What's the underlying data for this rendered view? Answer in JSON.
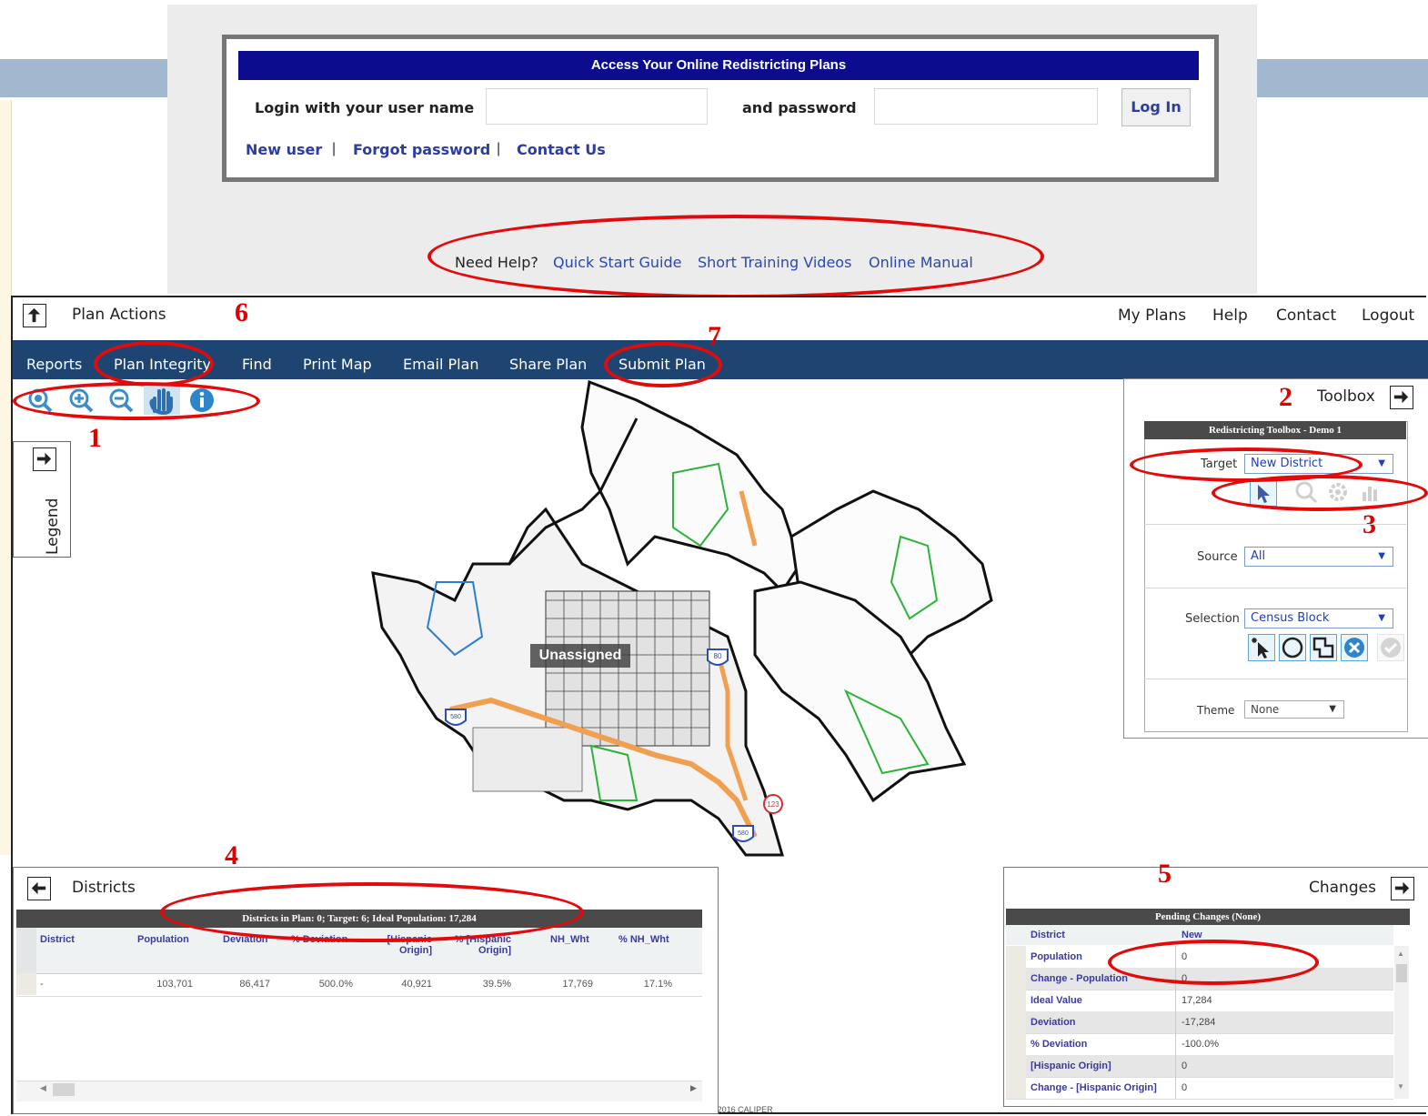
{
  "login": {
    "header": "Access Your Online Redistricting Plans",
    "username_label": "Login with your user name",
    "password_label": "and password",
    "login_button": "Log In",
    "links": {
      "new_user": "New user",
      "forgot_password": "Forgot password",
      "contact_us": "Contact Us",
      "sep": "|"
    }
  },
  "help": {
    "prefix": "Need Help?",
    "quick_start": "Quick Start Guide",
    "videos": "Short Training Videos",
    "manual": "Online Manual"
  },
  "topbar": {
    "title": "Plan Actions",
    "right_links": [
      "My Plans",
      "Help",
      "Contact",
      "Logout"
    ]
  },
  "menu": [
    "Reports",
    "Plan Integrity",
    "Find",
    "Print Map",
    "Email Plan",
    "Share Plan",
    "Submit Plan"
  ],
  "annotations": [
    "1",
    "2",
    "3",
    "4",
    "5",
    "6",
    "7"
  ],
  "legend": {
    "label": "Legend"
  },
  "map": {
    "label": "Unassigned",
    "shields": [
      "80",
      "580",
      "123",
      "580"
    ],
    "copyright": "©2016 CALIPER"
  },
  "toolbox": {
    "heading": "Toolbox",
    "panel_title": "Redistricting Toolbox - Demo 1",
    "target": {
      "label": "Target",
      "value": "New District"
    },
    "source": {
      "label": "Source",
      "value": "All"
    },
    "selection": {
      "label": "Selection",
      "value": "Census Block"
    },
    "theme": {
      "label": "Theme",
      "value": "None"
    }
  },
  "districts": {
    "heading": "Districts",
    "table_title": "Districts in Plan: 0; Target: 6; Ideal Population: 17,284",
    "columns": [
      "District",
      "Population",
      "Deviation",
      "% Deviation",
      "[Hispanic Origin]",
      "% [Hispanic Origin]",
      "NH_Wht",
      "% NH_Wht"
    ],
    "rows": [
      [
        "-",
        "103,701",
        "86,417",
        "500.0%",
        "40,921",
        "39.5%",
        "17,769",
        "17.1%"
      ]
    ]
  },
  "changes": {
    "heading": "Changes",
    "table_title": "Pending Changes (None)",
    "header_row": {
      "label": "District",
      "value": "New"
    },
    "rows": [
      {
        "label": "Population",
        "value": "0"
      },
      {
        "label": "Change - Population",
        "value": "0"
      },
      {
        "label": "Ideal Value",
        "value": "17,284"
      },
      {
        "label": "Deviation",
        "value": "-17,284"
      },
      {
        "label": "% Deviation",
        "value": "-100.0%"
      },
      {
        "label": "[Hispanic Origin]",
        "value": "0"
      },
      {
        "label": "Change - [Hispanic Origin]",
        "value": "0"
      }
    ]
  },
  "colors": {
    "menu_bar": "#1e4572",
    "login_header": "#0c0d8e",
    "annotation_red": "#e30a0a",
    "link_blue": "#2b3d9e"
  }
}
